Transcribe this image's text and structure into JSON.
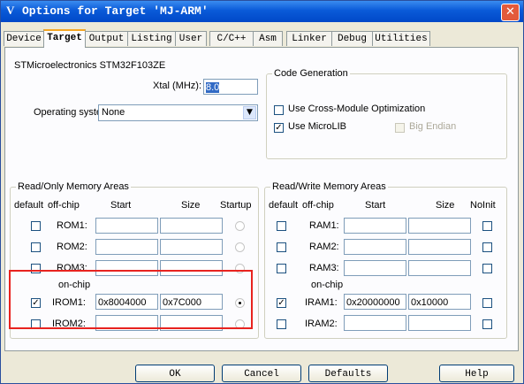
{
  "window": {
    "title": "Options for Target 'MJ-ARM'",
    "close_glyph": "✕",
    "app_glyph": "V"
  },
  "tabs": [
    "Device",
    "Target",
    "Output",
    "Listing",
    "User",
    "C/C++",
    "Asm",
    "Linker",
    "Debug",
    "Utilities"
  ],
  "active_tab": "Target",
  "device_name": "STMicroelectronics STM32F103ZE",
  "xtal": {
    "label": "Xtal (MHz):",
    "value": "8.0"
  },
  "os": {
    "label": "Operating system:",
    "value": "None"
  },
  "codegen": {
    "title": "Code Generation",
    "cross_module": {
      "label": "Use Cross-Module Optimization",
      "checked": false
    },
    "microlib": {
      "label": "Use MicroLIB",
      "checked": true
    },
    "big_endian": {
      "label": "Big Endian",
      "checked": false,
      "enabled": false
    }
  },
  "rom": {
    "title": "Read/Only Memory Areas",
    "headers": {
      "default": "default",
      "offchip": "off-chip",
      "start": "Start",
      "size": "Size",
      "startup": "Startup"
    },
    "onchip_label": "on-chip",
    "rows": [
      {
        "name": "ROM1:",
        "default": false,
        "start": "",
        "size": "",
        "startup": false
      },
      {
        "name": "ROM2:",
        "default": false,
        "start": "",
        "size": "",
        "startup": false
      },
      {
        "name": "ROM3:",
        "default": false,
        "start": "",
        "size": "",
        "startup": false
      },
      {
        "name": "IROM1:",
        "default": true,
        "start": "0x8004000",
        "size": "0x7C000",
        "startup": true
      },
      {
        "name": "IROM2:",
        "default": false,
        "start": "",
        "size": "",
        "startup": false
      }
    ]
  },
  "ram": {
    "title": "Read/Write Memory Areas",
    "headers": {
      "default": "default",
      "offchip": "off-chip",
      "start": "Start",
      "size": "Size",
      "noinit": "NoInit"
    },
    "onchip_label": "on-chip",
    "rows": [
      {
        "name": "RAM1:",
        "default": false,
        "start": "",
        "size": "",
        "noinit": false
      },
      {
        "name": "RAM2:",
        "default": false,
        "start": "",
        "size": "",
        "noinit": false
      },
      {
        "name": "RAM3:",
        "default": false,
        "start": "",
        "size": "",
        "noinit": false
      },
      {
        "name": "IRAM1:",
        "default": true,
        "start": "0x20000000",
        "size": "0x10000",
        "noinit": false
      },
      {
        "name": "IRAM2:",
        "default": false,
        "start": "",
        "size": "",
        "noinit": false
      }
    ]
  },
  "buttons": {
    "ok": "OK",
    "cancel": "Cancel",
    "defaults": "Defaults",
    "help": "Help"
  },
  "highlight_color": "#e8231f",
  "check_glyph": "✓"
}
